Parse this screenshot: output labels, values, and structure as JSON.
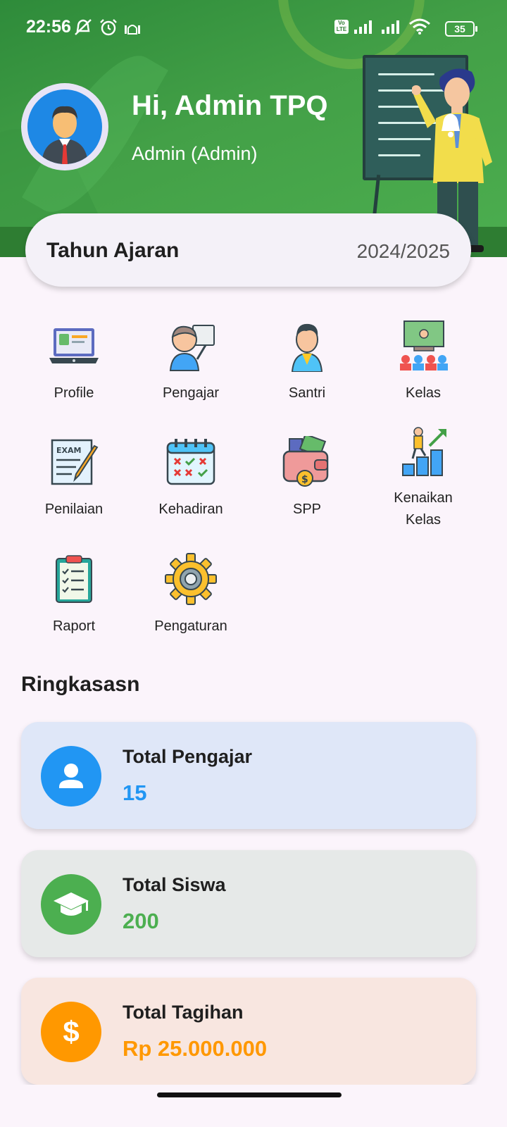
{
  "status_bar": {
    "time": "22:56",
    "battery": "35",
    "icons": [
      "mute-icon",
      "alarm-icon",
      "mosque-icon",
      "volte-icon",
      "signal-icon",
      "signal-icon",
      "wifi-icon",
      "battery-icon"
    ],
    "volte_text": "Vo LTE"
  },
  "header": {
    "greeting": "Hi, Admin TPQ",
    "role": "Admin (Admin)",
    "background_color": "#43a047"
  },
  "academic_year": {
    "label": "Tahun Ajaran",
    "value": "2024/2025"
  },
  "menu": {
    "items": [
      {
        "label": "Profile",
        "icon": "laptop-profile-icon"
      },
      {
        "label": "Pengajar",
        "icon": "teacher-icon"
      },
      {
        "label": "Santri",
        "icon": "student-icon"
      },
      {
        "label": "Kelas",
        "icon": "classroom-icon"
      },
      {
        "label": "Penilaian",
        "icon": "exam-icon"
      },
      {
        "label": "Kehadiran",
        "icon": "calendar-attendance-icon"
      },
      {
        "label": "SPP",
        "icon": "wallet-icon"
      },
      {
        "label": "Kenaikan Kelas",
        "icon": "promotion-icon"
      },
      {
        "label": "Raport",
        "icon": "clipboard-icon"
      },
      {
        "label": "Pengaturan",
        "icon": "gear-icon"
      }
    ],
    "exam_text": "EXAM"
  },
  "summary": {
    "title": "Ringkasasn",
    "cards": [
      {
        "title": "Total Pengajar",
        "value": "15",
        "icon": "person-icon",
        "bg": "#dfe7f8",
        "accent": "#2196f3"
      },
      {
        "title": "Total Siswa",
        "value": "200",
        "icon": "graduation-cap-icon",
        "bg": "#e6e9e8",
        "accent": "#4caf50"
      },
      {
        "title": "Total Tagihan",
        "value": "Rp 25.000.000",
        "icon": "dollar-icon",
        "bg": "#f8e6e0",
        "accent": "#ff9800"
      }
    ],
    "dollar_symbol": "$"
  }
}
